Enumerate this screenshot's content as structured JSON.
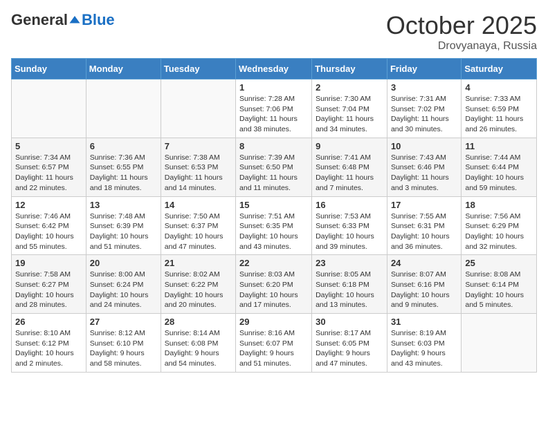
{
  "header": {
    "logo": {
      "general": "General",
      "blue": "Blue"
    },
    "title": "October 2025",
    "location": "Drovyanaya, Russia"
  },
  "weekdays": [
    "Sunday",
    "Monday",
    "Tuesday",
    "Wednesday",
    "Thursday",
    "Friday",
    "Saturday"
  ],
  "weeks": [
    [
      {
        "day": "",
        "info": ""
      },
      {
        "day": "",
        "info": ""
      },
      {
        "day": "",
        "info": ""
      },
      {
        "day": "1",
        "info": "Sunrise: 7:28 AM\nSunset: 7:06 PM\nDaylight: 11 hours and 38 minutes."
      },
      {
        "day": "2",
        "info": "Sunrise: 7:30 AM\nSunset: 7:04 PM\nDaylight: 11 hours and 34 minutes."
      },
      {
        "day": "3",
        "info": "Sunrise: 7:31 AM\nSunset: 7:02 PM\nDaylight: 11 hours and 30 minutes."
      },
      {
        "day": "4",
        "info": "Sunrise: 7:33 AM\nSunset: 6:59 PM\nDaylight: 11 hours and 26 minutes."
      }
    ],
    [
      {
        "day": "5",
        "info": "Sunrise: 7:34 AM\nSunset: 6:57 PM\nDaylight: 11 hours and 22 minutes."
      },
      {
        "day": "6",
        "info": "Sunrise: 7:36 AM\nSunset: 6:55 PM\nDaylight: 11 hours and 18 minutes."
      },
      {
        "day": "7",
        "info": "Sunrise: 7:38 AM\nSunset: 6:53 PM\nDaylight: 11 hours and 14 minutes."
      },
      {
        "day": "8",
        "info": "Sunrise: 7:39 AM\nSunset: 6:50 PM\nDaylight: 11 hours and 11 minutes."
      },
      {
        "day": "9",
        "info": "Sunrise: 7:41 AM\nSunset: 6:48 PM\nDaylight: 11 hours and 7 minutes."
      },
      {
        "day": "10",
        "info": "Sunrise: 7:43 AM\nSunset: 6:46 PM\nDaylight: 11 hours and 3 minutes."
      },
      {
        "day": "11",
        "info": "Sunrise: 7:44 AM\nSunset: 6:44 PM\nDaylight: 10 hours and 59 minutes."
      }
    ],
    [
      {
        "day": "12",
        "info": "Sunrise: 7:46 AM\nSunset: 6:42 PM\nDaylight: 10 hours and 55 minutes."
      },
      {
        "day": "13",
        "info": "Sunrise: 7:48 AM\nSunset: 6:39 PM\nDaylight: 10 hours and 51 minutes."
      },
      {
        "day": "14",
        "info": "Sunrise: 7:50 AM\nSunset: 6:37 PM\nDaylight: 10 hours and 47 minutes."
      },
      {
        "day": "15",
        "info": "Sunrise: 7:51 AM\nSunset: 6:35 PM\nDaylight: 10 hours and 43 minutes."
      },
      {
        "day": "16",
        "info": "Sunrise: 7:53 AM\nSunset: 6:33 PM\nDaylight: 10 hours and 39 minutes."
      },
      {
        "day": "17",
        "info": "Sunrise: 7:55 AM\nSunset: 6:31 PM\nDaylight: 10 hours and 36 minutes."
      },
      {
        "day": "18",
        "info": "Sunrise: 7:56 AM\nSunset: 6:29 PM\nDaylight: 10 hours and 32 minutes."
      }
    ],
    [
      {
        "day": "19",
        "info": "Sunrise: 7:58 AM\nSunset: 6:27 PM\nDaylight: 10 hours and 28 minutes."
      },
      {
        "day": "20",
        "info": "Sunrise: 8:00 AM\nSunset: 6:24 PM\nDaylight: 10 hours and 24 minutes."
      },
      {
        "day": "21",
        "info": "Sunrise: 8:02 AM\nSunset: 6:22 PM\nDaylight: 10 hours and 20 minutes."
      },
      {
        "day": "22",
        "info": "Sunrise: 8:03 AM\nSunset: 6:20 PM\nDaylight: 10 hours and 17 minutes."
      },
      {
        "day": "23",
        "info": "Sunrise: 8:05 AM\nSunset: 6:18 PM\nDaylight: 10 hours and 13 minutes."
      },
      {
        "day": "24",
        "info": "Sunrise: 8:07 AM\nSunset: 6:16 PM\nDaylight: 10 hours and 9 minutes."
      },
      {
        "day": "25",
        "info": "Sunrise: 8:08 AM\nSunset: 6:14 PM\nDaylight: 10 hours and 5 minutes."
      }
    ],
    [
      {
        "day": "26",
        "info": "Sunrise: 8:10 AM\nSunset: 6:12 PM\nDaylight: 10 hours and 2 minutes."
      },
      {
        "day": "27",
        "info": "Sunrise: 8:12 AM\nSunset: 6:10 PM\nDaylight: 9 hours and 58 minutes."
      },
      {
        "day": "28",
        "info": "Sunrise: 8:14 AM\nSunset: 6:08 PM\nDaylight: 9 hours and 54 minutes."
      },
      {
        "day": "29",
        "info": "Sunrise: 8:16 AM\nSunset: 6:07 PM\nDaylight: 9 hours and 51 minutes."
      },
      {
        "day": "30",
        "info": "Sunrise: 8:17 AM\nSunset: 6:05 PM\nDaylight: 9 hours and 47 minutes."
      },
      {
        "day": "31",
        "info": "Sunrise: 8:19 AM\nSunset: 6:03 PM\nDaylight: 9 hours and 43 minutes."
      },
      {
        "day": "",
        "info": ""
      }
    ]
  ]
}
